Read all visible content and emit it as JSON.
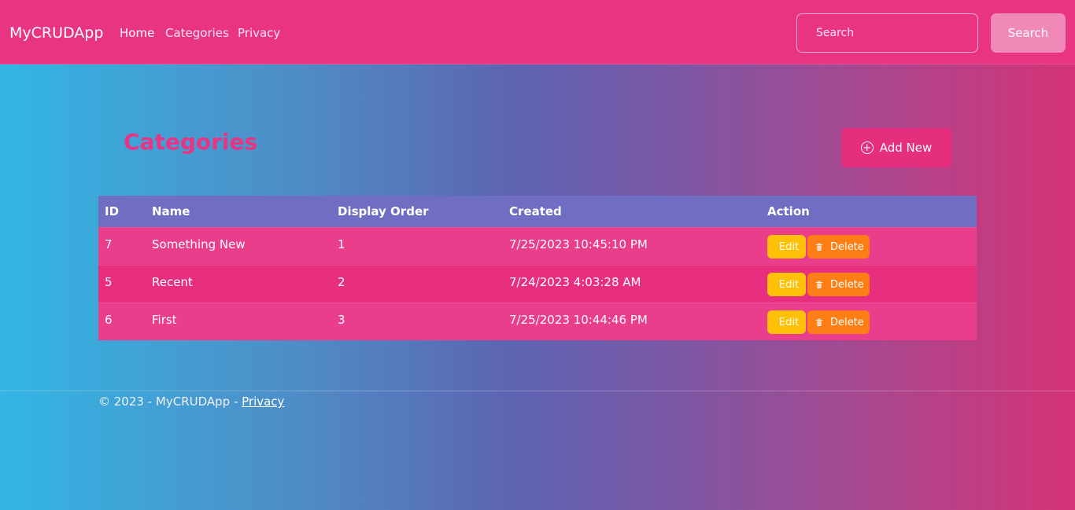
{
  "navbar": {
    "brand": "MyCRUDApp",
    "links": [
      "Home",
      "Categories",
      "Privacy"
    ],
    "search_placeholder": "Search",
    "search_button": "Search"
  },
  "main": {
    "title": "Categories",
    "add_button": "Add New",
    "add_icon": "plus-circle-icon",
    "table": {
      "headers": [
        "ID",
        "Name",
        "Display Order",
        "Created",
        "Action"
      ],
      "rows": [
        {
          "id": "7",
          "name": "Something New",
          "display_order": "1",
          "created": "7/25/2023 10:45:10 PM",
          "edit": "Edit",
          "delete": "Delete"
        },
        {
          "id": "5",
          "name": "Recent",
          "display_order": "2",
          "created": "7/24/2023 4:03:28 AM",
          "edit": "Edit",
          "delete": "Delete"
        },
        {
          "id": "6",
          "name": "First",
          "display_order": "3",
          "created": "7/25/2023 10:44:46 PM",
          "edit": "Edit",
          "delete": "Delete"
        }
      ]
    }
  },
  "footer": {
    "text": "© 2023 - MyCRUDApp - ",
    "privacy_link": "Privacy"
  },
  "colors": {
    "navbar": "#e93383",
    "title": "#e93383",
    "table_header": "#6f6ec2",
    "edit_button": "#ffc107",
    "delete_button": "#fd7e14"
  }
}
